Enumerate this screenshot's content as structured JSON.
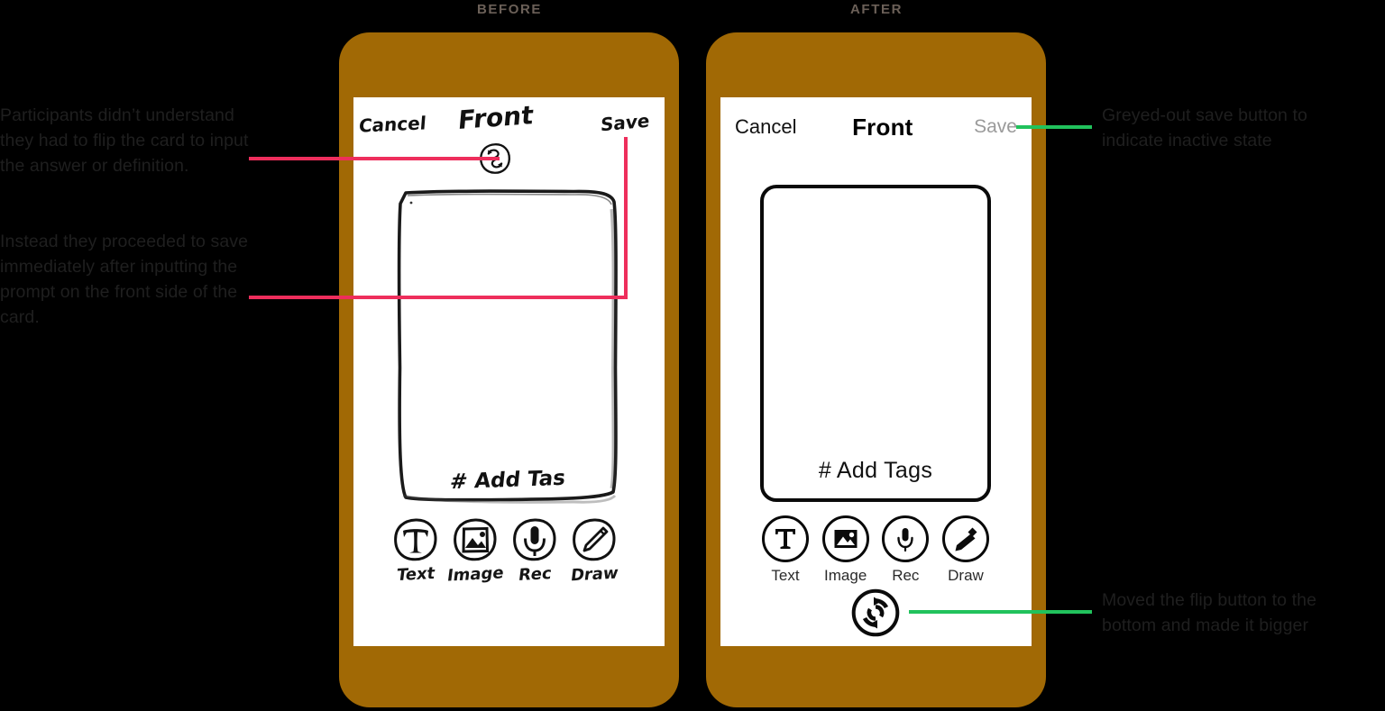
{
  "sections": {
    "before_label": "BEFORE",
    "after_label": "AFTER"
  },
  "colors": {
    "background": "#000000",
    "phone_body": "#A16905",
    "screen": "#FFFFFF",
    "annotation_text": "#1F1F1F",
    "section_label": "#6B6058",
    "pink_connector": "#EE2E5C",
    "green_connector": "#21C25C",
    "save_disabled": "#9A9A9A"
  },
  "before_screen": {
    "nav": {
      "cancel": "Cancel",
      "title": "Front",
      "save": "Save"
    },
    "flip_icon": "flip-card-icon",
    "card": {
      "add_tags": "# Add Tas"
    },
    "tools": [
      {
        "label": "Text",
        "icon": "text-icon"
      },
      {
        "label": "Image",
        "icon": "image-icon"
      },
      {
        "label": "Rec",
        "icon": "microphone-icon"
      },
      {
        "label": "Draw",
        "icon": "pencil-icon"
      }
    ]
  },
  "after_screen": {
    "nav": {
      "cancel": "Cancel",
      "title": "Front",
      "save": "Save"
    },
    "card": {
      "add_tags": "# Add Tags"
    },
    "tools": [
      {
        "label": "Text",
        "icon": "text-icon"
      },
      {
        "label": "Image",
        "icon": "image-icon"
      },
      {
        "label": "Rec",
        "icon": "microphone-icon"
      },
      {
        "label": "Draw",
        "icon": "pencil-icon"
      }
    ],
    "flip_icon": "flip-card-icon"
  },
  "annotations": {
    "left_1": "Participants didn’t understand they had to flip the card to input the answer or definition.",
    "left_2": "Instead they proceeded to save immediately after inputting  the prompt on the front side of the card.",
    "right_1": "Greyed-out save button to indicate inactive state",
    "right_2": "Moved the flip button to the bottom and made it bigger"
  }
}
